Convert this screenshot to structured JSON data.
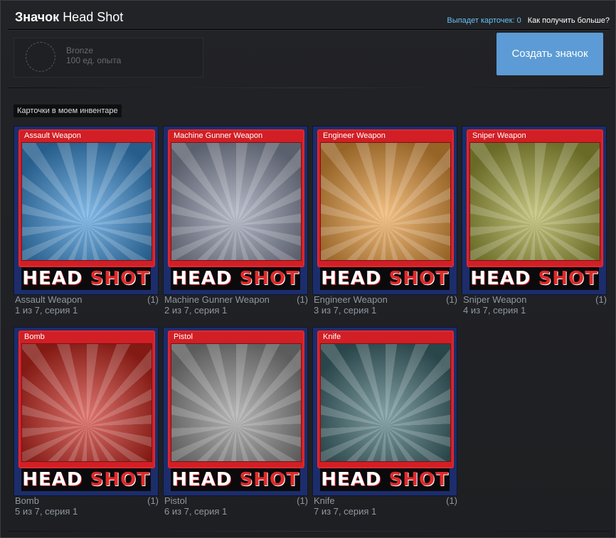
{
  "header": {
    "title_bold": "Значок",
    "title_rest": "Head Shot",
    "drops_label": "Выпадет карточек:",
    "drops_count": "0",
    "more_link": "Как получить больше?"
  },
  "badge": {
    "level": "Bronze",
    "xp": "100 ед. опыта"
  },
  "craft_button": "Создать значок",
  "section_label": "Карточки в моем инвентаре",
  "logo": {
    "head": "HEAD",
    "shot": "SHOT"
  },
  "cards": [
    {
      "name": "Assault Weapon",
      "count": "(1)",
      "series": "1 из 7, серия 1",
      "bg": "#3a8fd6"
    },
    {
      "name": "Machine Gunner Weapon",
      "count": "(1)",
      "series": "2 из 7, серия 1",
      "bg": "#8c93a8"
    },
    {
      "name": "Engineer Weapon",
      "count": "(1)",
      "series": "3 из 7, серия 1",
      "bg": "#e89a3c"
    },
    {
      "name": "Sniper Weapon",
      "count": "(1)",
      "series": "4 из 7, серия 1",
      "bg": "#a3a33c"
    },
    {
      "name": "Bomb",
      "count": "(1)",
      "series": "5 из 7, серия 1",
      "bg": "#c9281f"
    },
    {
      "name": "Pistol",
      "count": "(1)",
      "series": "6 из 7, серия 1",
      "bg": "#8e8e8e"
    },
    {
      "name": "Knife",
      "count": "(1)",
      "series": "7 из 7, серия 1",
      "bg": "#3f6b72"
    }
  ]
}
